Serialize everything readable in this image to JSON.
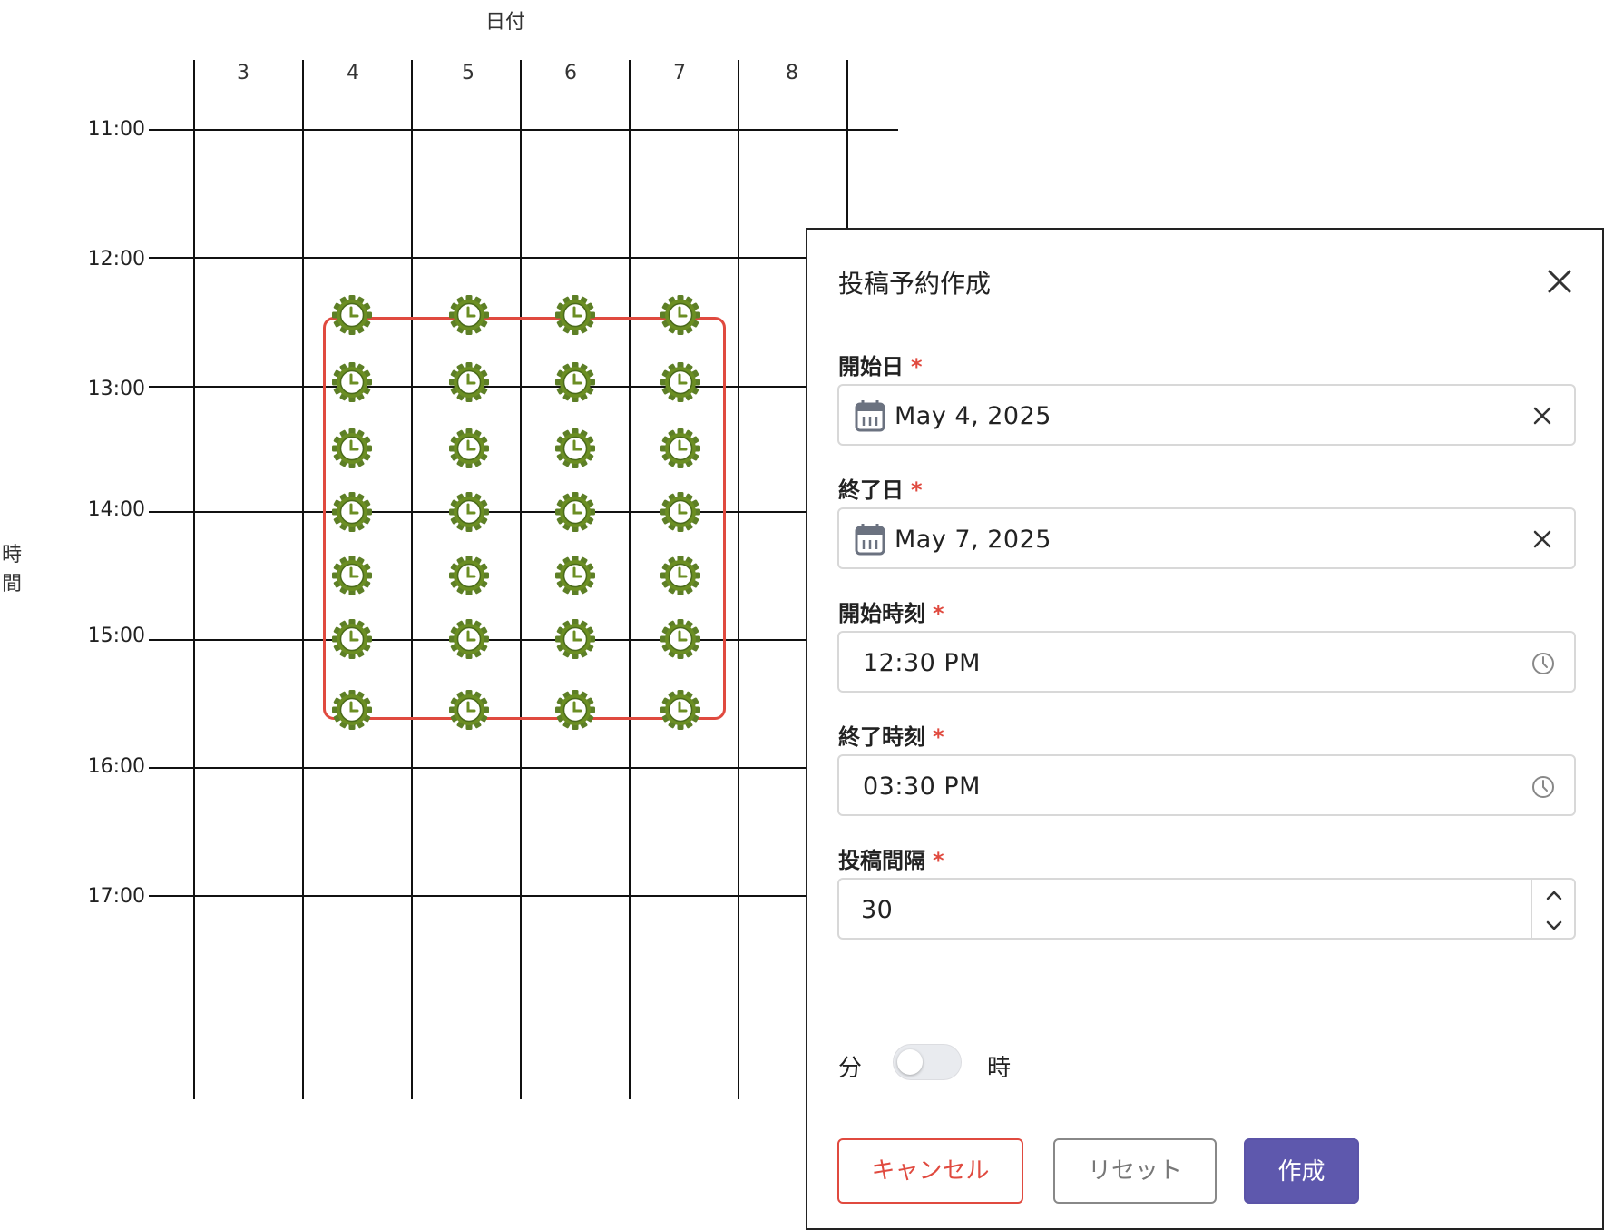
{
  "calendar": {
    "x_axis_title": "日付",
    "y_axis_title_chars": [
      "時",
      "間"
    ],
    "columns": [
      "3",
      "4",
      "5",
      "6",
      "7",
      "8"
    ],
    "rows": [
      "11:00",
      "12:00",
      "13:00",
      "14:00",
      "15:00",
      "16:00",
      "17:00"
    ],
    "selection_color": "#e04a3f",
    "marker_icon": "gear-clock-icon",
    "marker_color": "#6b8e23"
  },
  "dialog": {
    "title": "投稿予約作成",
    "required_mark": "*",
    "start_date": {
      "label": "開始日",
      "value": "May 4, 2025"
    },
    "end_date": {
      "label": "終了日",
      "value": "May 7, 2025"
    },
    "start_time": {
      "label": "開始時刻",
      "value": "12:30 PM"
    },
    "end_time": {
      "label": "終了時刻",
      "value": "03:30 PM"
    },
    "interval": {
      "label": "投稿間隔",
      "value": "30"
    },
    "unit_toggle": {
      "left_label": "分",
      "right_label": "時",
      "checked": false
    },
    "buttons": {
      "cancel": "キャンセル",
      "reset": "リセット",
      "create": "作成"
    },
    "accent_color": "#5e58ad"
  }
}
